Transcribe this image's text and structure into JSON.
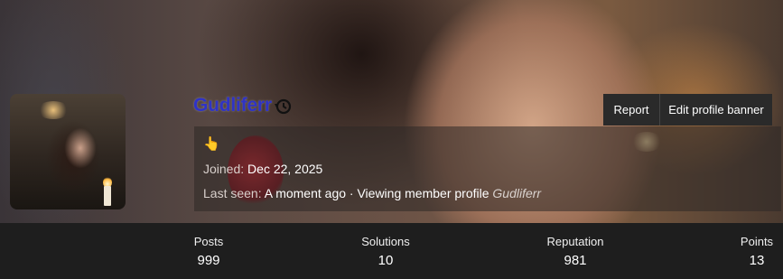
{
  "profile": {
    "username": "Gudliferr",
    "username_color": "#2f33c6",
    "username_icon": "history-icon",
    "status_emoji": "👆",
    "joined_label": "Joined:",
    "joined_value": "Dec 22, 2025",
    "last_seen_label": "Last seen:",
    "last_seen_value": "A moment ago",
    "separator": "·",
    "activity_text": "Viewing member profile",
    "activity_target": "Gudliferr"
  },
  "actions": {
    "report_label": "Report",
    "edit_banner_label": "Edit profile banner"
  },
  "stats": [
    {
      "label": "Posts",
      "value": "999"
    },
    {
      "label": "Solutions",
      "value": "10"
    },
    {
      "label": "Reputation",
      "value": "981"
    },
    {
      "label": "Points",
      "value": "13"
    }
  ],
  "colors": {
    "button_bg": "#2a2a2a",
    "stats_bg": "#1e1e1e"
  }
}
